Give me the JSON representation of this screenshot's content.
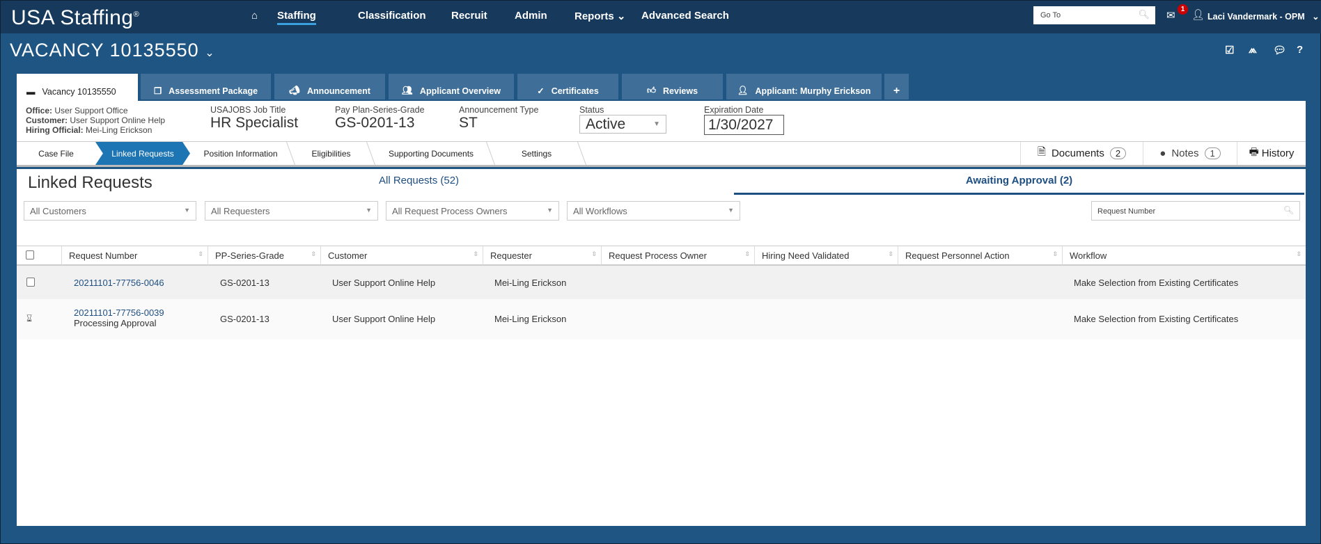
{
  "header": {
    "logo": "USA Staffing",
    "logo_mark": "®",
    "nav": [
      "Staffing",
      "Classification",
      "Recruit",
      "Admin",
      "Reports",
      "Advanced Search"
    ],
    "goto_placeholder": "Go To",
    "mail_count": "1",
    "user": "Laci Vandermark - OPM"
  },
  "vacancy": {
    "title": "VACANCY 10135550"
  },
  "tabs": [
    "Vacancy 10135550",
    "Assessment Package",
    "Announcement",
    "Applicant Overview",
    "Certificates",
    "Reviews",
    "Applicant: Murphy Erickson",
    "+"
  ],
  "info": {
    "office_label": "Office:",
    "office": "User Support Office",
    "customer_label": "Customer:",
    "customer": "User Support Online Help",
    "hiring_label": "Hiring Official:",
    "hiring": "Mei-Ling Erickson",
    "job_title_label": "USAJOBS Job Title",
    "job_title": "HR Specialist",
    "ppsg_label": "Pay Plan-Series-Grade",
    "ppsg": "GS-0201-13",
    "ann_type_label": "Announcement Type",
    "ann_type": "ST",
    "status_label": "Status",
    "status": "Active",
    "exp_label": "Expiration Date",
    "exp": "1/30/2027"
  },
  "steps": [
    "Case File",
    "Linked Requests",
    "Position Information",
    "Eligibilities",
    "Supporting Documents",
    "Settings"
  ],
  "side": {
    "documents": "Documents",
    "documents_count": "2",
    "notes": "Notes",
    "notes_count": "1",
    "history": "History"
  },
  "main": {
    "heading": "Linked Requests",
    "tab_all": "All Requests (52)",
    "tab_awaiting": "Awaiting Approval (2)",
    "filters": [
      "All Customers",
      "All Requesters",
      "All Request Process Owners",
      "All Workflows"
    ],
    "search_placeholder": "Request Number",
    "columns": [
      "Request Number",
      "PP-Series-Grade",
      "Customer",
      "Requester",
      "Request Process Owner",
      "Hiring Need Validated",
      "Request Personnel Action",
      "Workflow"
    ],
    "rows": [
      {
        "number": "20211101-77756-0046",
        "status": "",
        "ppsg": "GS-0201-13",
        "customer": "User Support Online Help",
        "requester": "Mei-Ling Erickson",
        "workflow": "Make Selection from Existing Certificates"
      },
      {
        "number": "20211101-77756-0039",
        "status": "Processing Approval",
        "ppsg": "GS-0201-13",
        "customer": "User Support Online Help",
        "requester": "Mei-Ling Erickson",
        "workflow": "Make Selection from Existing Certificates"
      }
    ]
  }
}
